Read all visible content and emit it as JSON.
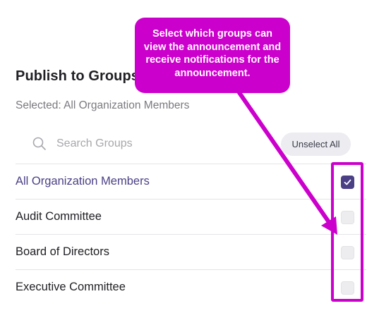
{
  "callout": {
    "text": "Select which groups can view the announcement and receive notifications for the announcement."
  },
  "panel": {
    "title": "Publish to Groups",
    "selected_text": "Selected: All Organization Members"
  },
  "search": {
    "placeholder": "Search Groups",
    "value": "",
    "icon": "search-icon"
  },
  "unselect_all_label": "Unselect All",
  "groups": [
    {
      "label": "All Organization Members",
      "checked": true
    },
    {
      "label": "Audit Committee",
      "checked": false
    },
    {
      "label": "Board of Directors",
      "checked": false
    },
    {
      "label": "Executive Committee",
      "checked": false
    }
  ],
  "colors": {
    "accent": "#4b3f86",
    "annotation": "#cc00cc",
    "muted_text": "#7a7a80",
    "checkbox_empty": "#ededf0"
  }
}
